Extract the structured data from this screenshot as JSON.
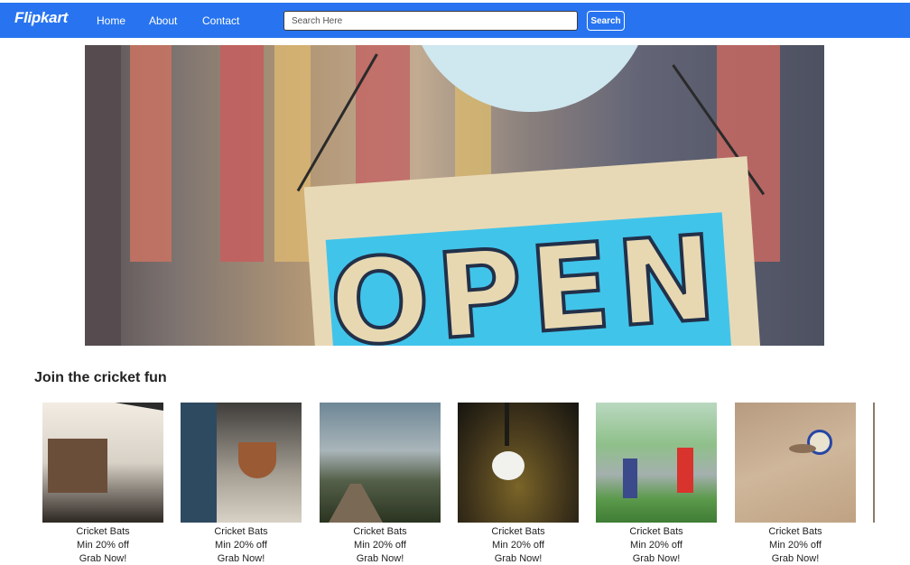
{
  "navbar": {
    "logo": "Flipkart",
    "links": [
      "Home",
      "About",
      "Contact"
    ],
    "search_placeholder": "Search Here",
    "search_button": "Search"
  },
  "hero": {
    "sign_text": "OPEN"
  },
  "section": {
    "title": "Join the cricket fun"
  },
  "cards": [
    {
      "title": "Cricket Bats",
      "offer": "Min 20% off",
      "cta": "Grab Now!"
    },
    {
      "title": "Cricket Bats",
      "offer": "Min 20% off",
      "cta": "Grab Now!"
    },
    {
      "title": "Cricket Bats",
      "offer": "Min 20% off",
      "cta": "Grab Now!"
    },
    {
      "title": "Cricket Bats",
      "offer": "Min 20% off",
      "cta": "Grab Now!"
    },
    {
      "title": "Cricket Bats",
      "offer": "Min 20% off",
      "cta": "Grab Now!"
    },
    {
      "title": "Cricket Bats",
      "offer": "Min 20% off",
      "cta": "Grab Now!"
    }
  ],
  "colors": {
    "navbar": "#2874f0",
    "text": "#222222"
  }
}
